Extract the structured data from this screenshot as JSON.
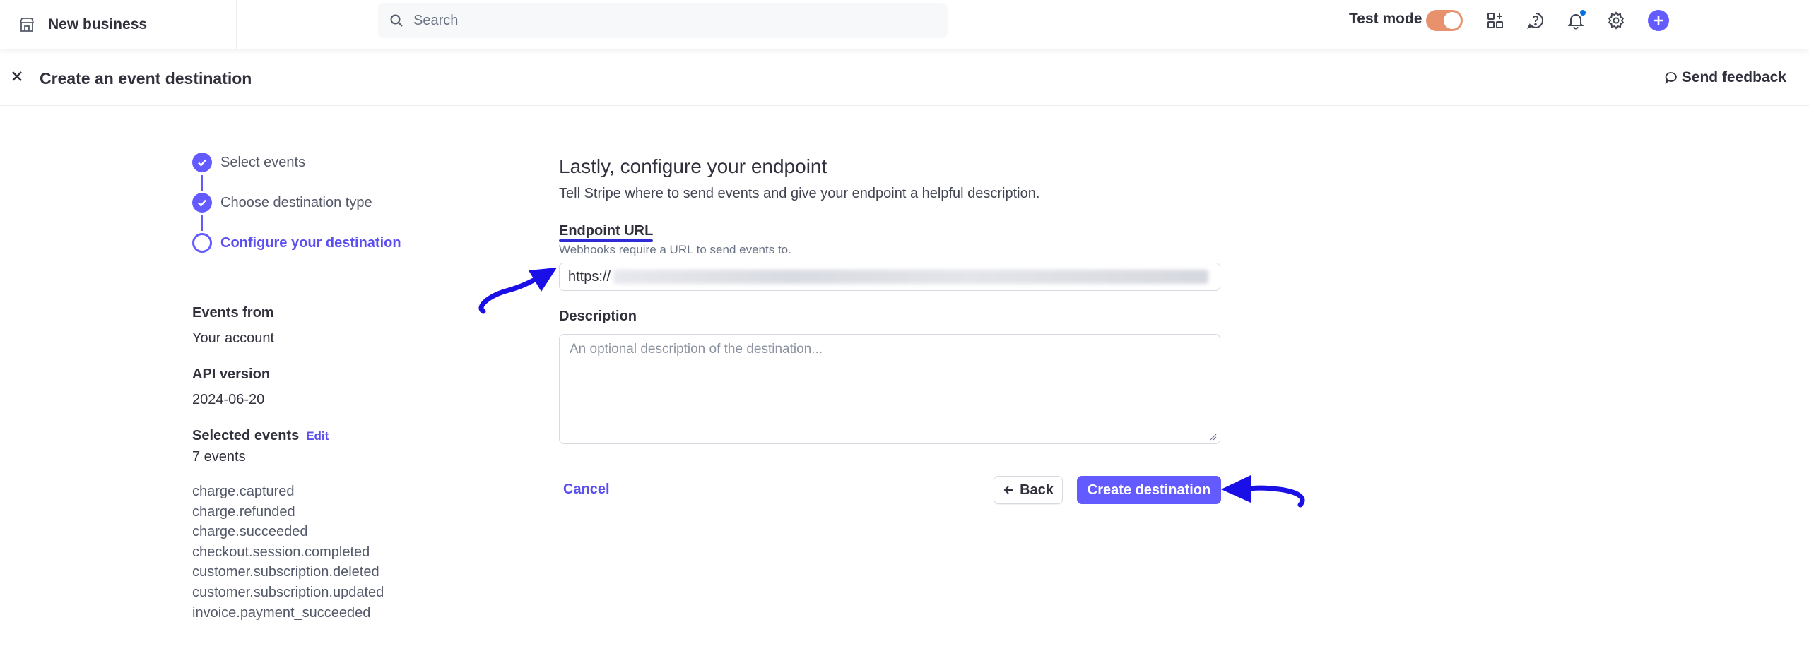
{
  "topbar": {
    "account_name": "New business",
    "search_placeholder": "Search",
    "test_mode_label": "Test mode",
    "test_mode_on": true,
    "accent_color": "#635bff",
    "toggle_color": "#e7916d",
    "icons": [
      "store-icon",
      "search-icon",
      "apps-icon",
      "help-icon",
      "notifications-icon",
      "settings-icon",
      "add-icon"
    ]
  },
  "subheader": {
    "title": "Create an event destination",
    "feedback_label": "Send feedback"
  },
  "steps": [
    {
      "label": "Select events",
      "state": "complete"
    },
    {
      "label": "Choose destination type",
      "state": "complete"
    },
    {
      "label": "Configure your destination",
      "state": "active"
    }
  ],
  "summary": {
    "events_from_label": "Events from",
    "events_from_value": "Your account",
    "api_version_label": "API version",
    "api_version_value": "2024-06-20",
    "selected_events_label": "Selected events",
    "edit_label": "Edit",
    "events_count": "7 events",
    "events": [
      "charge.captured",
      "charge.refunded",
      "charge.succeeded",
      "checkout.session.completed",
      "customer.subscription.deleted",
      "customer.subscription.updated",
      "invoice.payment_succeeded"
    ]
  },
  "form": {
    "title": "Lastly, configure your endpoint",
    "description": "Tell Stripe where to send events and give your endpoint a helpful description.",
    "endpoint_label": "Endpoint URL",
    "endpoint_help": "Webhooks require a URL to send events to.",
    "endpoint_value": "https://",
    "description_label": "Description",
    "description_placeholder": "An optional description of the destination...",
    "cancel_label": "Cancel",
    "back_label": "Back",
    "create_label": "Create destination"
  }
}
